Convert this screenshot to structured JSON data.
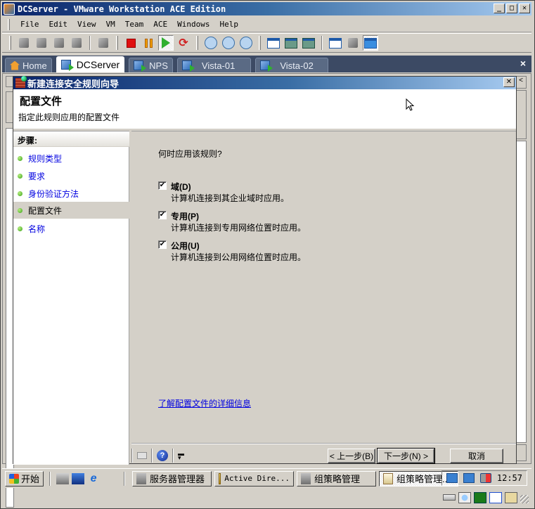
{
  "host": {
    "title": "DCServer - VMware Workstation ACE Edition",
    "window_buttons": [
      "minimize",
      "maximize",
      "close"
    ],
    "menu": [
      "File",
      "Edit",
      "View",
      "VM",
      "Team",
      "ACE",
      "Windows",
      "Help"
    ],
    "toolbar": {
      "groups": [
        [
          "team-icon",
          "team-add-icon",
          "new-vm-icon",
          "usb-icon"
        ],
        [
          "console-icon"
        ],
        [
          "power-off-icon",
          "suspend-icon",
          "power-on-icon",
          "reset-icon"
        ],
        [
          "snapshot-icon",
          "revert-snapshot-icon",
          "snapshot-manager-icon"
        ],
        [
          "sidebar-view-icon",
          "full-screen-icon",
          "quick-switch-icon"
        ],
        [
          "summary-view-icon",
          "console-view-icon",
          "appliance-view-icon"
        ]
      ],
      "pressed": [
        "power-on-icon",
        "appliance-view-icon"
      ]
    },
    "tabs": [
      {
        "label": "Home",
        "icon": "home-icon",
        "active": false
      },
      {
        "label": "DCServer",
        "icon": "vm-icon",
        "active": true
      },
      {
        "label": "NPS",
        "icon": "vm-icon",
        "active": false
      },
      {
        "label": "Vista-01",
        "icon": "vm-icon",
        "active": false
      },
      {
        "label": "Vista-02",
        "icon": "vm-icon",
        "active": false
      }
    ],
    "tab_close": "×"
  },
  "wizard": {
    "title": "新建连接安全规则向导",
    "close_glyph": "✕",
    "heading": "配置文件",
    "subtitle": "指定此规则应用的配置文件",
    "steps_header": "步骤:",
    "steps": [
      {
        "label": "规则类型",
        "current": false
      },
      {
        "label": "要求",
        "current": false
      },
      {
        "label": "身份验证方法",
        "current": false
      },
      {
        "label": "配置文件",
        "current": true
      },
      {
        "label": "名称",
        "current": false
      }
    ],
    "question": "何时应用该规则?",
    "options": [
      {
        "label": "域(D)",
        "description": "计算机连接到其企业域时应用。",
        "checked": true
      },
      {
        "label": "专用(P)",
        "description": "计算机连接到专用网络位置时应用。",
        "checked": true
      },
      {
        "label": "公用(U)",
        "description": "计算机连接到公用网络位置时应用。",
        "checked": true
      }
    ],
    "learn_more_link": "了解配置文件的详细信息",
    "buttons": {
      "back": "< 上一步(B)",
      "next": "下一步(N) >",
      "cancel": "取消"
    },
    "check_glyph": "✔"
  },
  "taskbar": {
    "start_label": "开始",
    "quick_launch": [
      "server-manager-icon",
      "desktop-icon",
      "internet-explorer-icon"
    ],
    "tasks": [
      {
        "label": "服务器管理器",
        "active": false
      },
      {
        "label": "Active Dire...",
        "active": false
      },
      {
        "label": "组策略管理",
        "active": false
      },
      {
        "label": "组策略管理...",
        "active": true
      }
    ],
    "tray_icons": [
      "vmware-tools-icon",
      "network-icon",
      "volume-muted-icon"
    ],
    "clock": "12:57"
  },
  "statusbar": {
    "devices": [
      "hard-disk-icon",
      "cd-rom-icon",
      "network-adapter-icon",
      "sound-icon",
      "message-log-icon"
    ]
  }
}
